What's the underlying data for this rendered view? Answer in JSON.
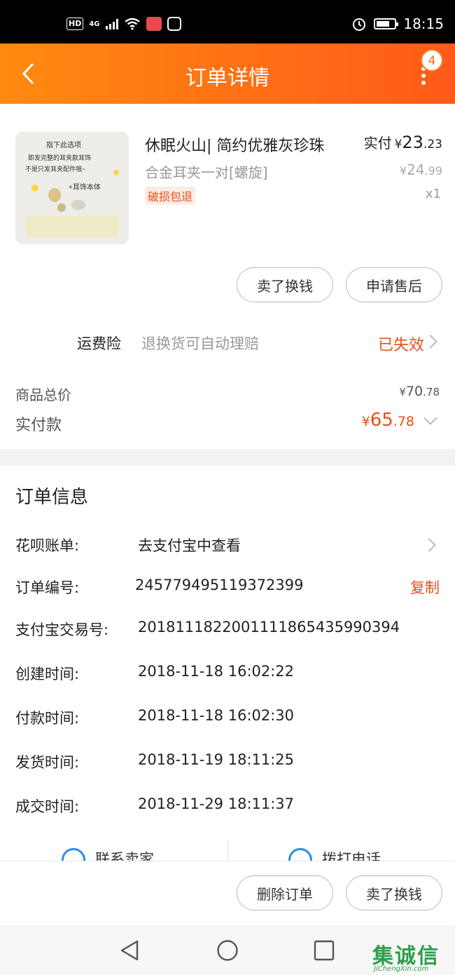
{
  "status_bar": {
    "time": "18:15",
    "hd": "HD",
    "network": "4G"
  },
  "app_bar": {
    "title": "订单详情",
    "menu_badge": "4"
  },
  "product": {
    "name": "休眠火山|  简约优雅灰珍珠",
    "spec": "合金耳夹一对[螺旋]",
    "tag": "破损包退",
    "paid_label": "实付",
    "currency": "¥",
    "paid_int": "23",
    "paid_dec": ".23",
    "original_price_int": "24",
    "original_price_dec": ".99",
    "quantity": "x1",
    "thumb_caption_1": "指下此选项",
    "thumb_caption_2": "即发完整的耳夹款耳饰",
    "thumb_caption_3": "不是只发耳夹配件哦~",
    "thumb_caption_4": "+耳饰本体"
  },
  "actions": {
    "sell_for_cash": "卖了换钱",
    "after_sale": "申请售后"
  },
  "insurance": {
    "label": "运费险",
    "desc": "退换货可自动理赔",
    "status": "已失效"
  },
  "totals": {
    "goods_total_label": "商品总价",
    "goods_total_int": "70",
    "goods_total_dec": ".78",
    "paid_label": "实付款",
    "paid_int": "65",
    "paid_dec": ".78",
    "currency": "¥"
  },
  "order_info": {
    "title": "订单信息",
    "rows": [
      {
        "label": "花呗账单:",
        "value": "去支付宝中查看"
      },
      {
        "label": "订单编号:",
        "value": "245779495119372399",
        "action": "复制"
      },
      {
        "label": "支付宝交易号:",
        "value": "2018111822001111865435990394"
      },
      {
        "label": "创建时间:",
        "value": "2018-11-18 16:02:22"
      },
      {
        "label": "付款时间:",
        "value": "2018-11-18 16:02:30"
      },
      {
        "label": "发货时间:",
        "value": "2018-11-19 18:11:25"
      },
      {
        "label": "成交时间:",
        "value": "2018-11-29 18:11:37"
      }
    ]
  },
  "contact": {
    "seller": "联系卖家",
    "call": "拨打电话"
  },
  "bottom_actions": {
    "delete_order": "删除订单",
    "sell_for_cash": "卖了换钱"
  },
  "watermark": {
    "text": "集诚信",
    "url": "JiChengXin.com"
  },
  "colors": {
    "accent": "#e8501a",
    "header_start": "#ff8a10",
    "header_end": "#ff5a1a"
  }
}
